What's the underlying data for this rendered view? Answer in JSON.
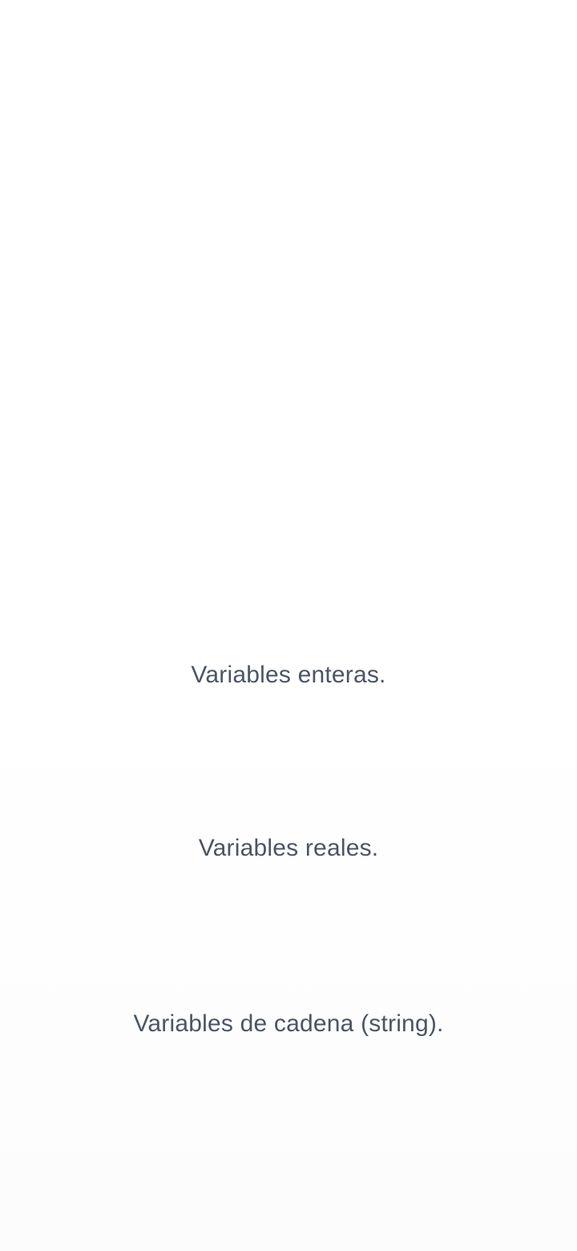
{
  "options": [
    {
      "label": "Variables enteras."
    },
    {
      "label": "Variables reales."
    },
    {
      "label": "Variables de cadena (string)."
    }
  ],
  "colors": {
    "text": "#4b5563",
    "background": "#ffffff"
  }
}
